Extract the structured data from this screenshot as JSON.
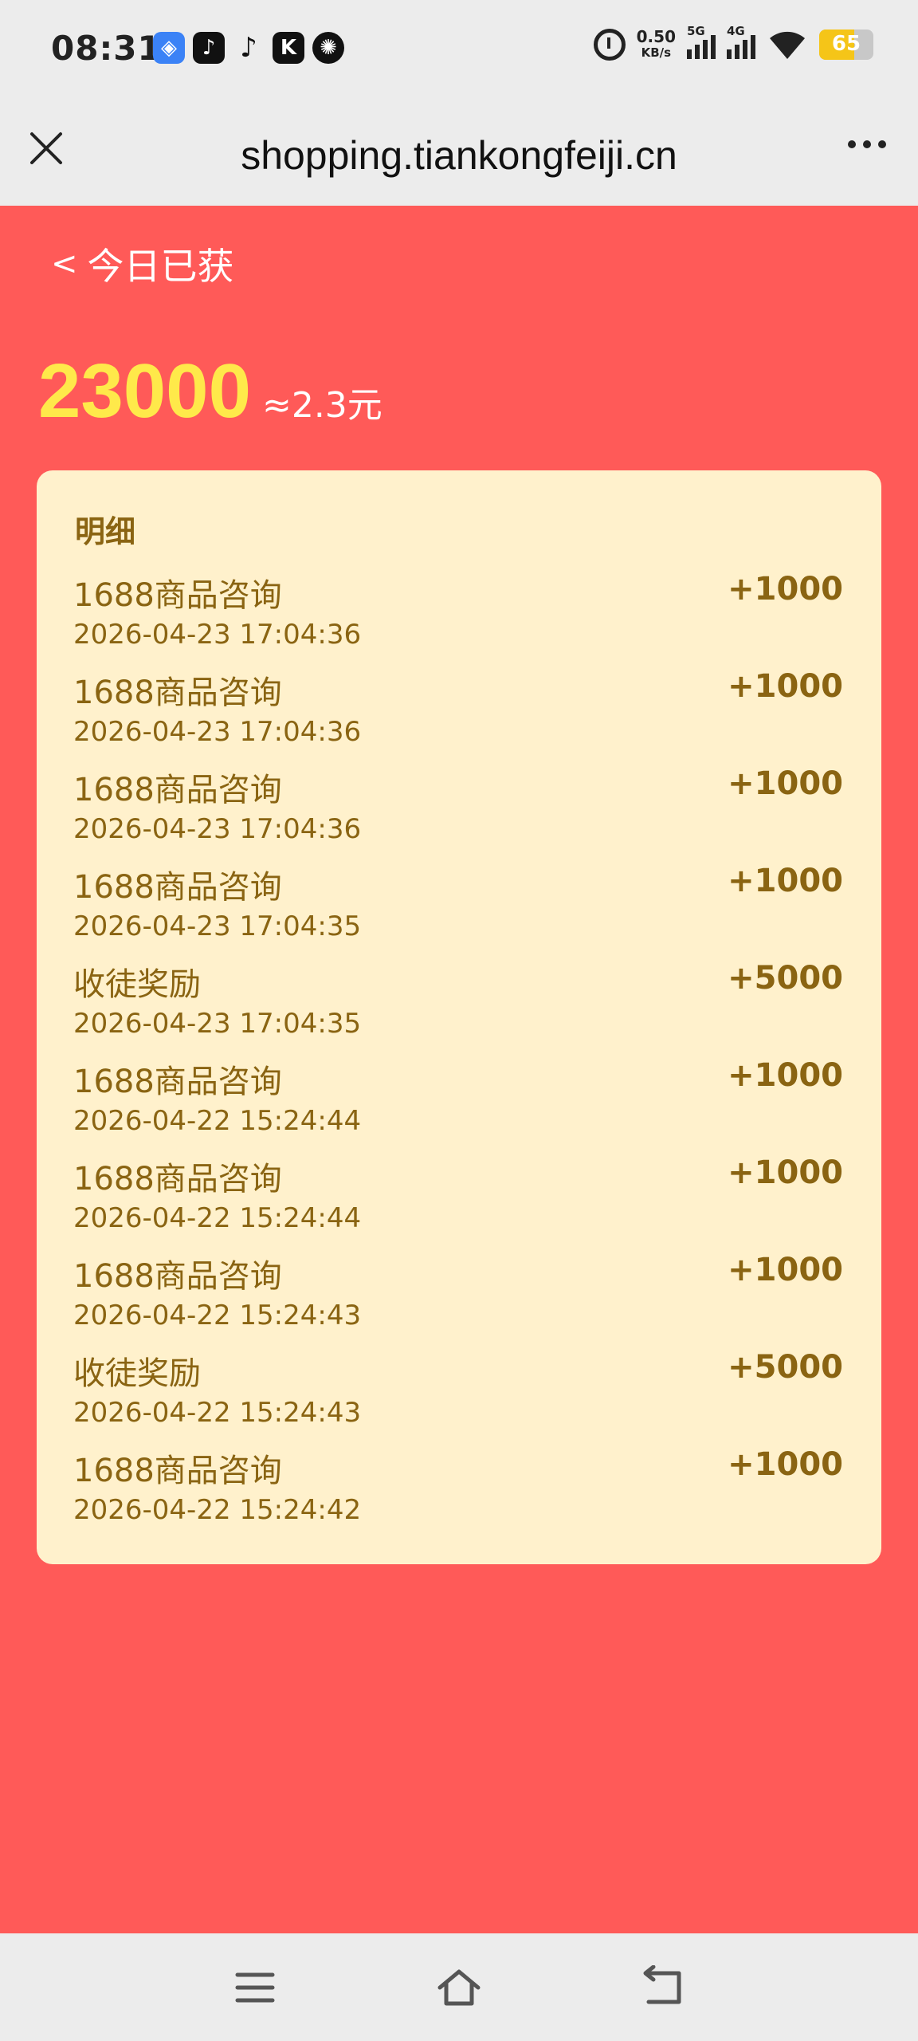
{
  "status_bar": {
    "time": "08:31",
    "net_speed": "0.50",
    "net_unit": "KB/s",
    "sim1": "5G",
    "sim2": "4G",
    "battery": "65",
    "icons": [
      "app-blue-icon",
      "tiktok-lite-icon",
      "tiktok-icon",
      "k-app-icon",
      "aperture-icon"
    ]
  },
  "browser": {
    "url": "shopping.tiankongfeiji.cn",
    "close_icon": "close-icon",
    "more_icon": "more-icon"
  },
  "header": {
    "back_chevron": "<",
    "title": "今日已获",
    "total": "23000",
    "approx": "≈2.3元"
  },
  "detail": {
    "title": "明细",
    "rows": [
      {
        "title": "1688商品咨询",
        "date": "2026-04-23 17:04:36",
        "amount": "+1000"
      },
      {
        "title": "1688商品咨询",
        "date": "2026-04-23 17:04:36",
        "amount": "+1000"
      },
      {
        "title": "1688商品咨询",
        "date": "2026-04-23 17:04:36",
        "amount": "+1000"
      },
      {
        "title": "1688商品咨询",
        "date": "2026-04-23 17:04:35",
        "amount": "+1000"
      },
      {
        "title": "收徒奖励",
        "date": "2026-04-23 17:04:35",
        "amount": "+5000"
      },
      {
        "title": "1688商品咨询",
        "date": "2026-04-22 15:24:44",
        "amount": "+1000"
      },
      {
        "title": "1688商品咨询",
        "date": "2026-04-22 15:24:44",
        "amount": "+1000"
      },
      {
        "title": "1688商品咨询",
        "date": "2026-04-22 15:24:43",
        "amount": "+1000"
      },
      {
        "title": "收徒奖励",
        "date": "2026-04-22 15:24:43",
        "amount": "+5000"
      },
      {
        "title": "1688商品咨询",
        "date": "2026-04-22 15:24:42",
        "amount": "+1000"
      }
    ]
  },
  "nav": {
    "icons": [
      "menu-icon",
      "home-icon",
      "back-icon"
    ]
  },
  "colors": {
    "page_bg": "#ff5a58",
    "card_bg": "#fff1cc",
    "total_color": "#ffe94a",
    "text_brown": "#8a6412"
  }
}
